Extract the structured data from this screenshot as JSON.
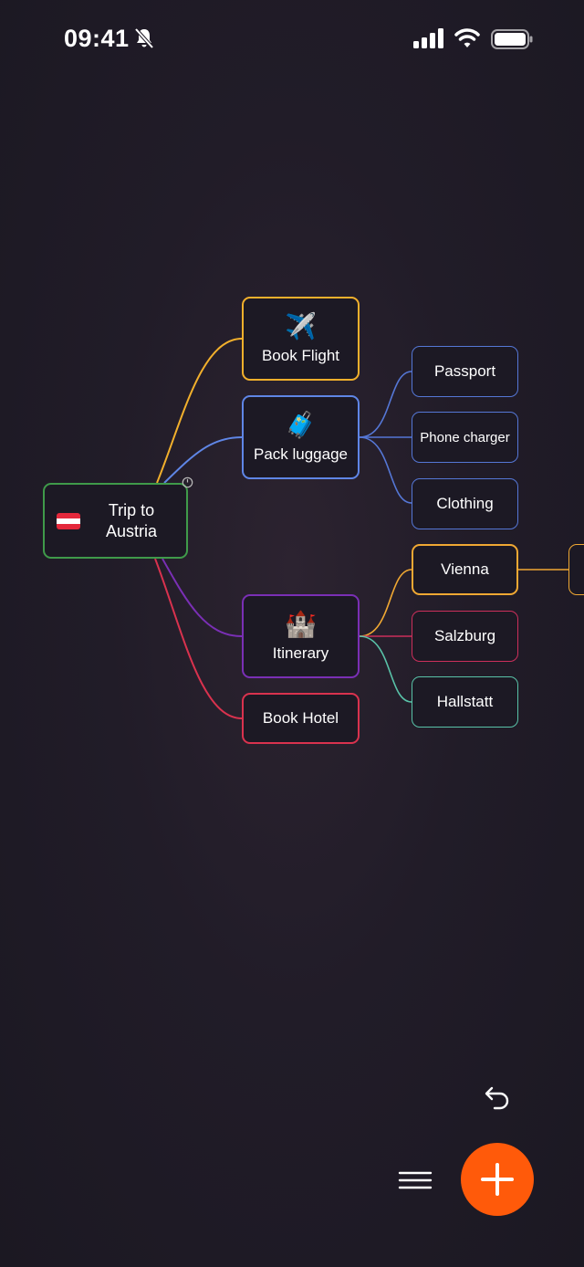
{
  "status_bar": {
    "time": "09:41",
    "icons": [
      "bell-slash-icon",
      "cellular-signal-icon",
      "wifi-icon",
      "battery-icon"
    ]
  },
  "mind_map": {
    "root": {
      "label": "Trip to Austria",
      "icon": "austria-flag-icon",
      "color": "#3f9a4a"
    },
    "branches": [
      {
        "label": "Book Flight",
        "icon": "airplane-icon",
        "emoji": "✈️",
        "color": "#f2b02c"
      },
      {
        "label": "Pack luggage",
        "icon": "suitcase-icon",
        "emoji": "🧳",
        "color": "#5f86e6",
        "children": [
          "Passport",
          "Phone charger",
          "Clothing"
        ]
      },
      {
        "label": "Itinerary",
        "icon": "castle-icon",
        "emoji": "🏰",
        "color": "#7a2fb5",
        "children": [
          "Vienna",
          "Salzburg",
          "Hallstatt"
        ]
      },
      {
        "label": "Book Hotel",
        "color": "#d9324e"
      }
    ],
    "leaf_colors": {
      "Vienna": "#f0a833",
      "Salzburg": "#cc2f5b",
      "Hallstatt": "#59c2a8",
      "luggage": "#5577d6"
    }
  },
  "toolbar": {
    "undo_icon": "undo-arrow-icon",
    "menu_icon": "hamburger-menu-icon",
    "add_icon": "plus-icon",
    "add_color": "#ff5a0a"
  }
}
